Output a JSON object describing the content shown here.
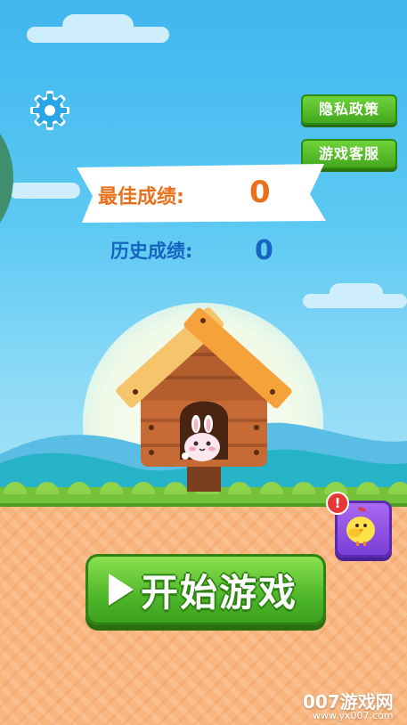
{
  "header": {
    "privacy_button": "隐私政策",
    "service_button": "游戏客服"
  },
  "scores": {
    "best_label": "最佳成绩:",
    "best_value": "0",
    "history_label": "历史成绩:",
    "history_value": "0"
  },
  "actions": {
    "start_label": "开始游戏",
    "alert_badge": "!"
  },
  "watermark": {
    "text": "007游戏网",
    "url": "www.yx007.com"
  },
  "icons": [
    "gear-icon",
    "play-icon",
    "chick-icon",
    "bunny-icon",
    "alert-icon"
  ],
  "colors": {
    "accent_green": "#4fb82a",
    "score_orange": "#e9711c",
    "score_blue": "#1565c0",
    "chick_button_purple": "#8a4fe0"
  }
}
